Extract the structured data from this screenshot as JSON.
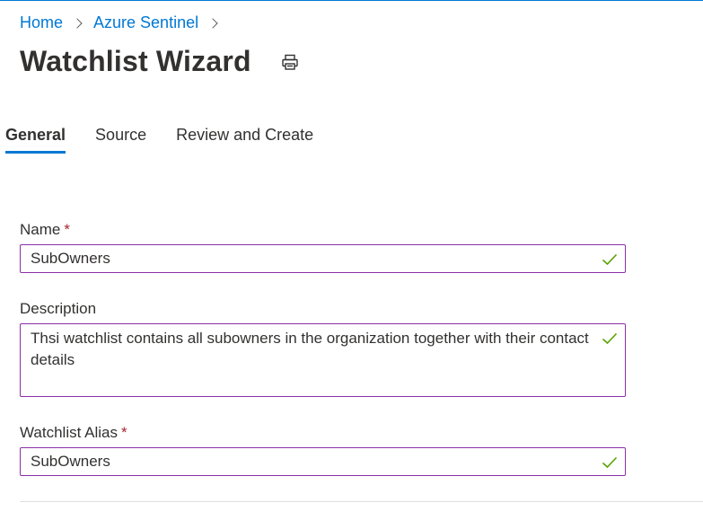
{
  "breadcrumb": {
    "home": "Home",
    "sentinel": "Azure Sentinel"
  },
  "header": {
    "title": "Watchlist Wizard",
    "print_icon": "print-icon"
  },
  "tabs": [
    {
      "label": "General",
      "active": true
    },
    {
      "label": "Source",
      "active": false
    },
    {
      "label": "Review and Create",
      "active": false
    }
  ],
  "form": {
    "name": {
      "label": "Name",
      "required_mark": "*",
      "value": "SubOwners"
    },
    "description": {
      "label": "Description",
      "value": "Thsi watchlist contains all subowners in the organization together with their contact details"
    },
    "alias": {
      "label": "Watchlist Alias",
      "required_mark": "*",
      "value": "SubOwners"
    }
  },
  "colors": {
    "accent": "#0078d4",
    "field_border": "#8a2fa7",
    "check": "#57a300",
    "required": "#a4262c"
  }
}
